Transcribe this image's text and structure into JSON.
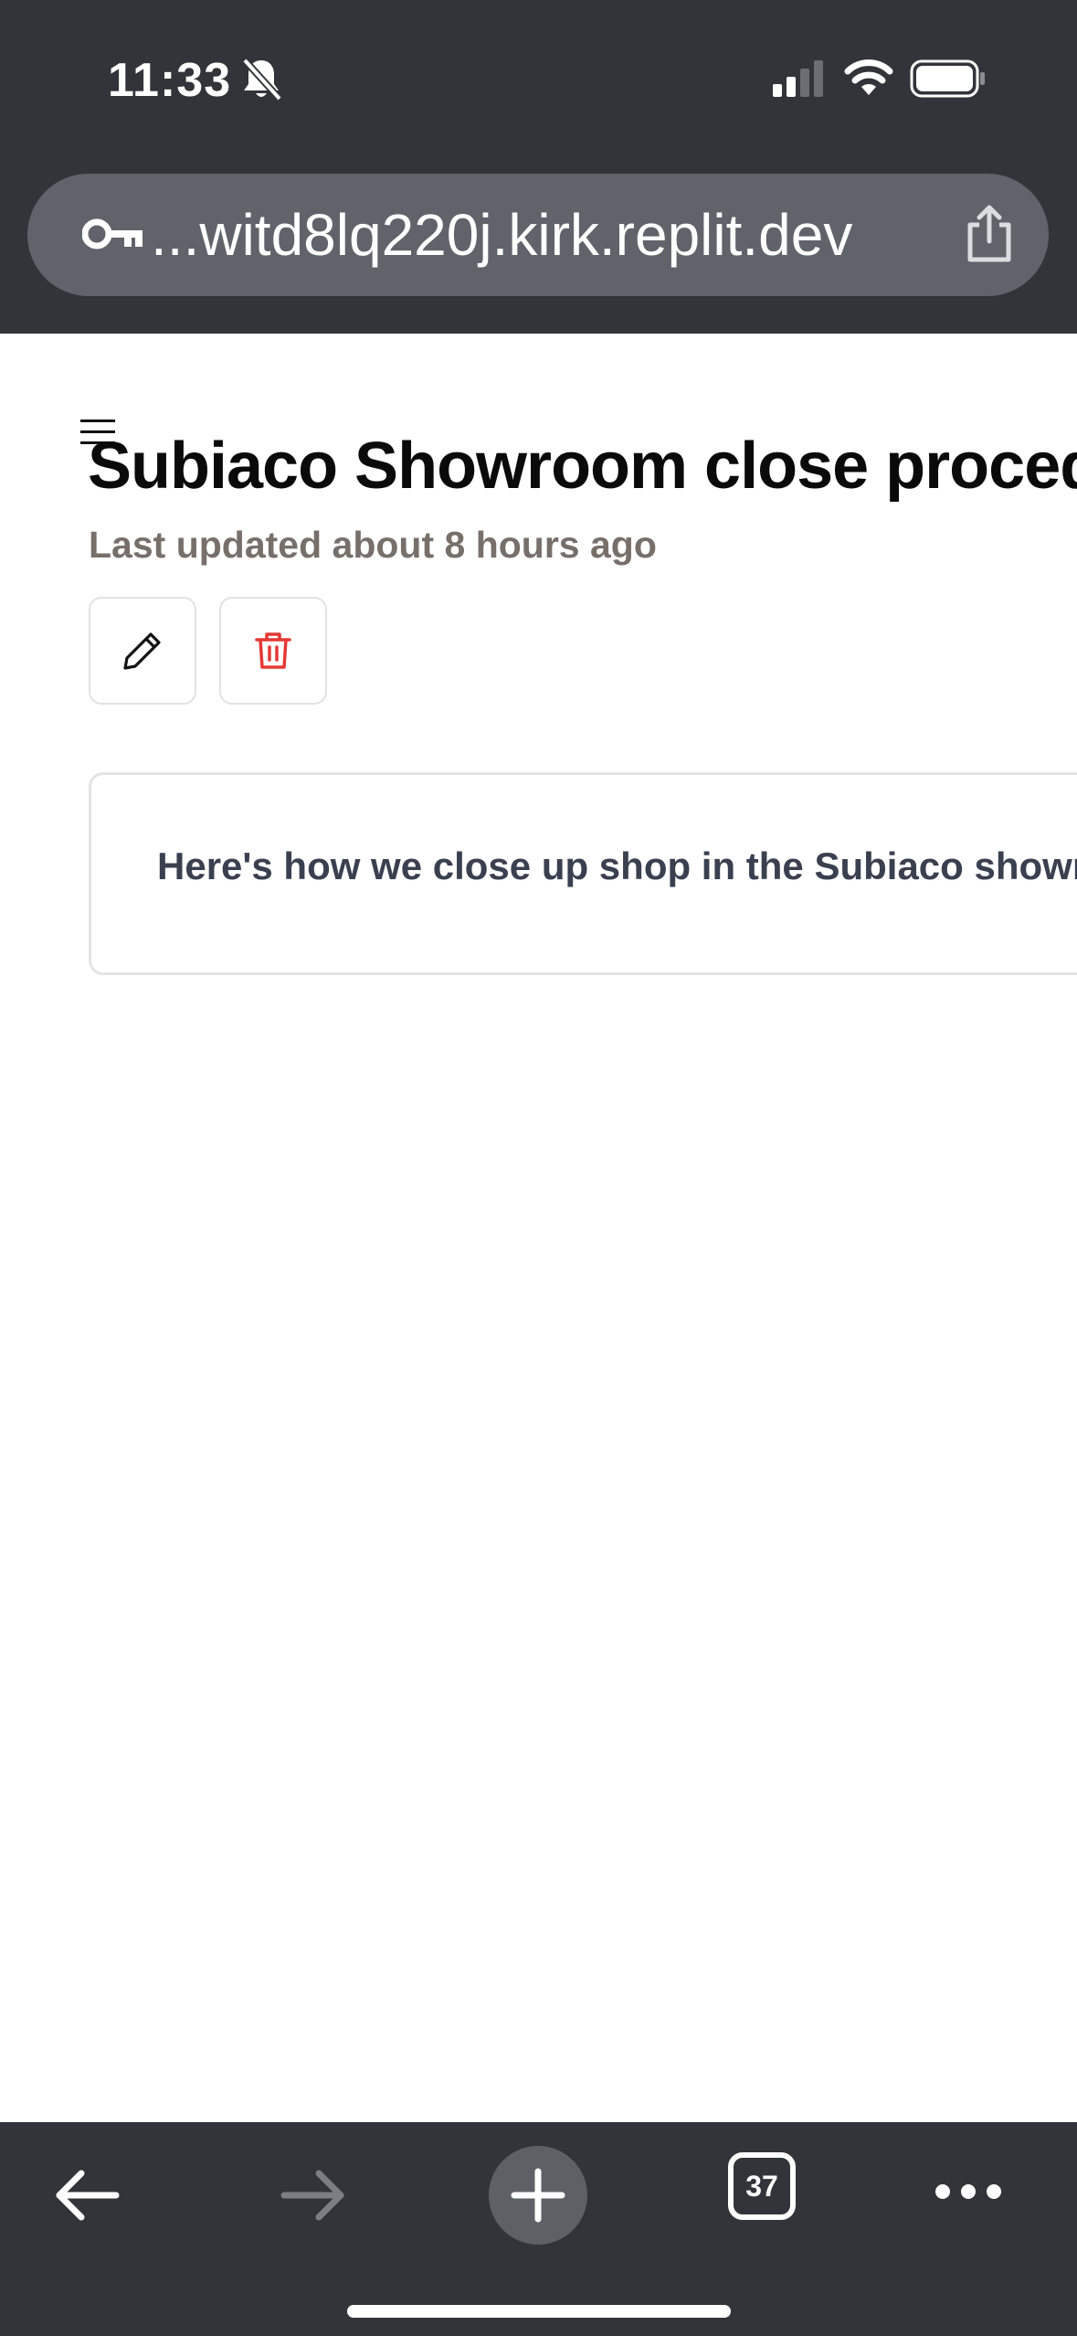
{
  "status_bar": {
    "time": "11:33",
    "icons": [
      "bell-slash-icon",
      "cellular-signal-icon",
      "wifi-icon",
      "battery-icon"
    ]
  },
  "browser": {
    "url": "...witd8lq220j.kirk.replit.dev",
    "url_icon": "key-icon",
    "share_icon": "share-icon"
  },
  "page": {
    "title": "Subiaco Showroom close procedure",
    "last_updated": "Last updated about 8 hours ago",
    "actions": [
      {
        "icon": "pencil-icon",
        "label": "Edit"
      },
      {
        "icon": "trash-icon",
        "label": "Delete"
      }
    ],
    "body_text": "Here's how we close up shop in the Subiaco showroom."
  },
  "toolbar": {
    "tab_count": "37",
    "buttons": [
      "back-arrow-icon",
      "forward-arrow-icon",
      "plus-icon",
      "tabs-icon",
      "more-icon"
    ]
  },
  "colors": {
    "chrome_bg": "#313438",
    "url_bar_bg": "#60646a",
    "delete_red": "#e53935",
    "muted_text": "#77706a"
  }
}
